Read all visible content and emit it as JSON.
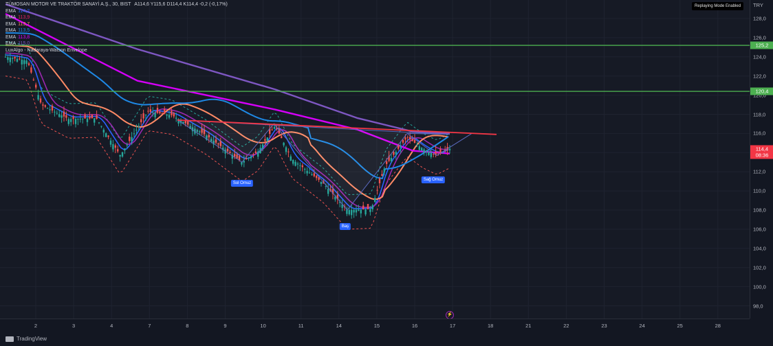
{
  "header": {
    "title": "TÜMOSAN MOTOR VE TRAKTÖR SANAYİ A.Ş., 30, BIST",
    "ohlc": "A114,6 Y115,6 D114,4 K114,4 -0,2 (-0,17%)"
  },
  "indicators": [
    {
      "name": "EMA",
      "value": "114,2",
      "color": "#2962ff"
    },
    {
      "name": "EMA",
      "value": "113,9",
      "color": "#e91e63"
    },
    {
      "name": "EMA",
      "value": "113,7",
      "color": "#ff8a65"
    },
    {
      "name": "EMA",
      "value": "113,5",
      "color": "#1e88e5"
    },
    {
      "name": "EMA",
      "value": "113,8",
      "color": "#d500f9"
    },
    {
      "name": "EMA",
      "value": "115,0",
      "color": "#7e57c2"
    },
    {
      "name": "LuxAlgo - Nadaraya-Watson Envelope",
      "value": "",
      "color": "#ef5350"
    }
  ],
  "replay_badge": "Replaying Mode Enabled",
  "currency": "TRY",
  "price_axis": [
    "128,0",
    "126,0",
    "124,0",
    "122,0",
    "120,0",
    "118,0",
    "116,0",
    "114,0",
    "112,0",
    "110,0",
    "108,0",
    "106,0",
    "104,0",
    "102,0",
    "100,0",
    "98,0"
  ],
  "price_tags": [
    {
      "text": "125,2",
      "price": 125.2,
      "bg": "#4caf50"
    },
    {
      "text": "120,4",
      "price": 120.4,
      "bg": "#4caf50"
    },
    {
      "text": "114,4",
      "price": 114.4,
      "bg": "#f23645"
    },
    {
      "text": "08:36",
      "price": 113.75,
      "bg": "#f23645"
    }
  ],
  "time_axis": [
    "2",
    "3",
    "4",
    "7",
    "8",
    "9",
    "10",
    "11",
    "14",
    "15",
    "16",
    "17",
    "18",
    "21",
    "22",
    "23",
    "24",
    "25",
    "28"
  ],
  "annotations": {
    "left_shoulder": "Sol Omuz",
    "head": "Baş",
    "right_shoulder": "Sağ Omuz"
  },
  "resistance_levels": [
    125.2,
    120.4
  ],
  "neckline": {
    "from": 117.4,
    "to": 115.9
  },
  "footer": {
    "brand": "TradingView"
  },
  "colors": {
    "background": "#161a25",
    "support_line": "#4caf50",
    "neckline": "#f23645",
    "candle_up": "#26a69a",
    "candle_down": "#ef5350"
  }
}
